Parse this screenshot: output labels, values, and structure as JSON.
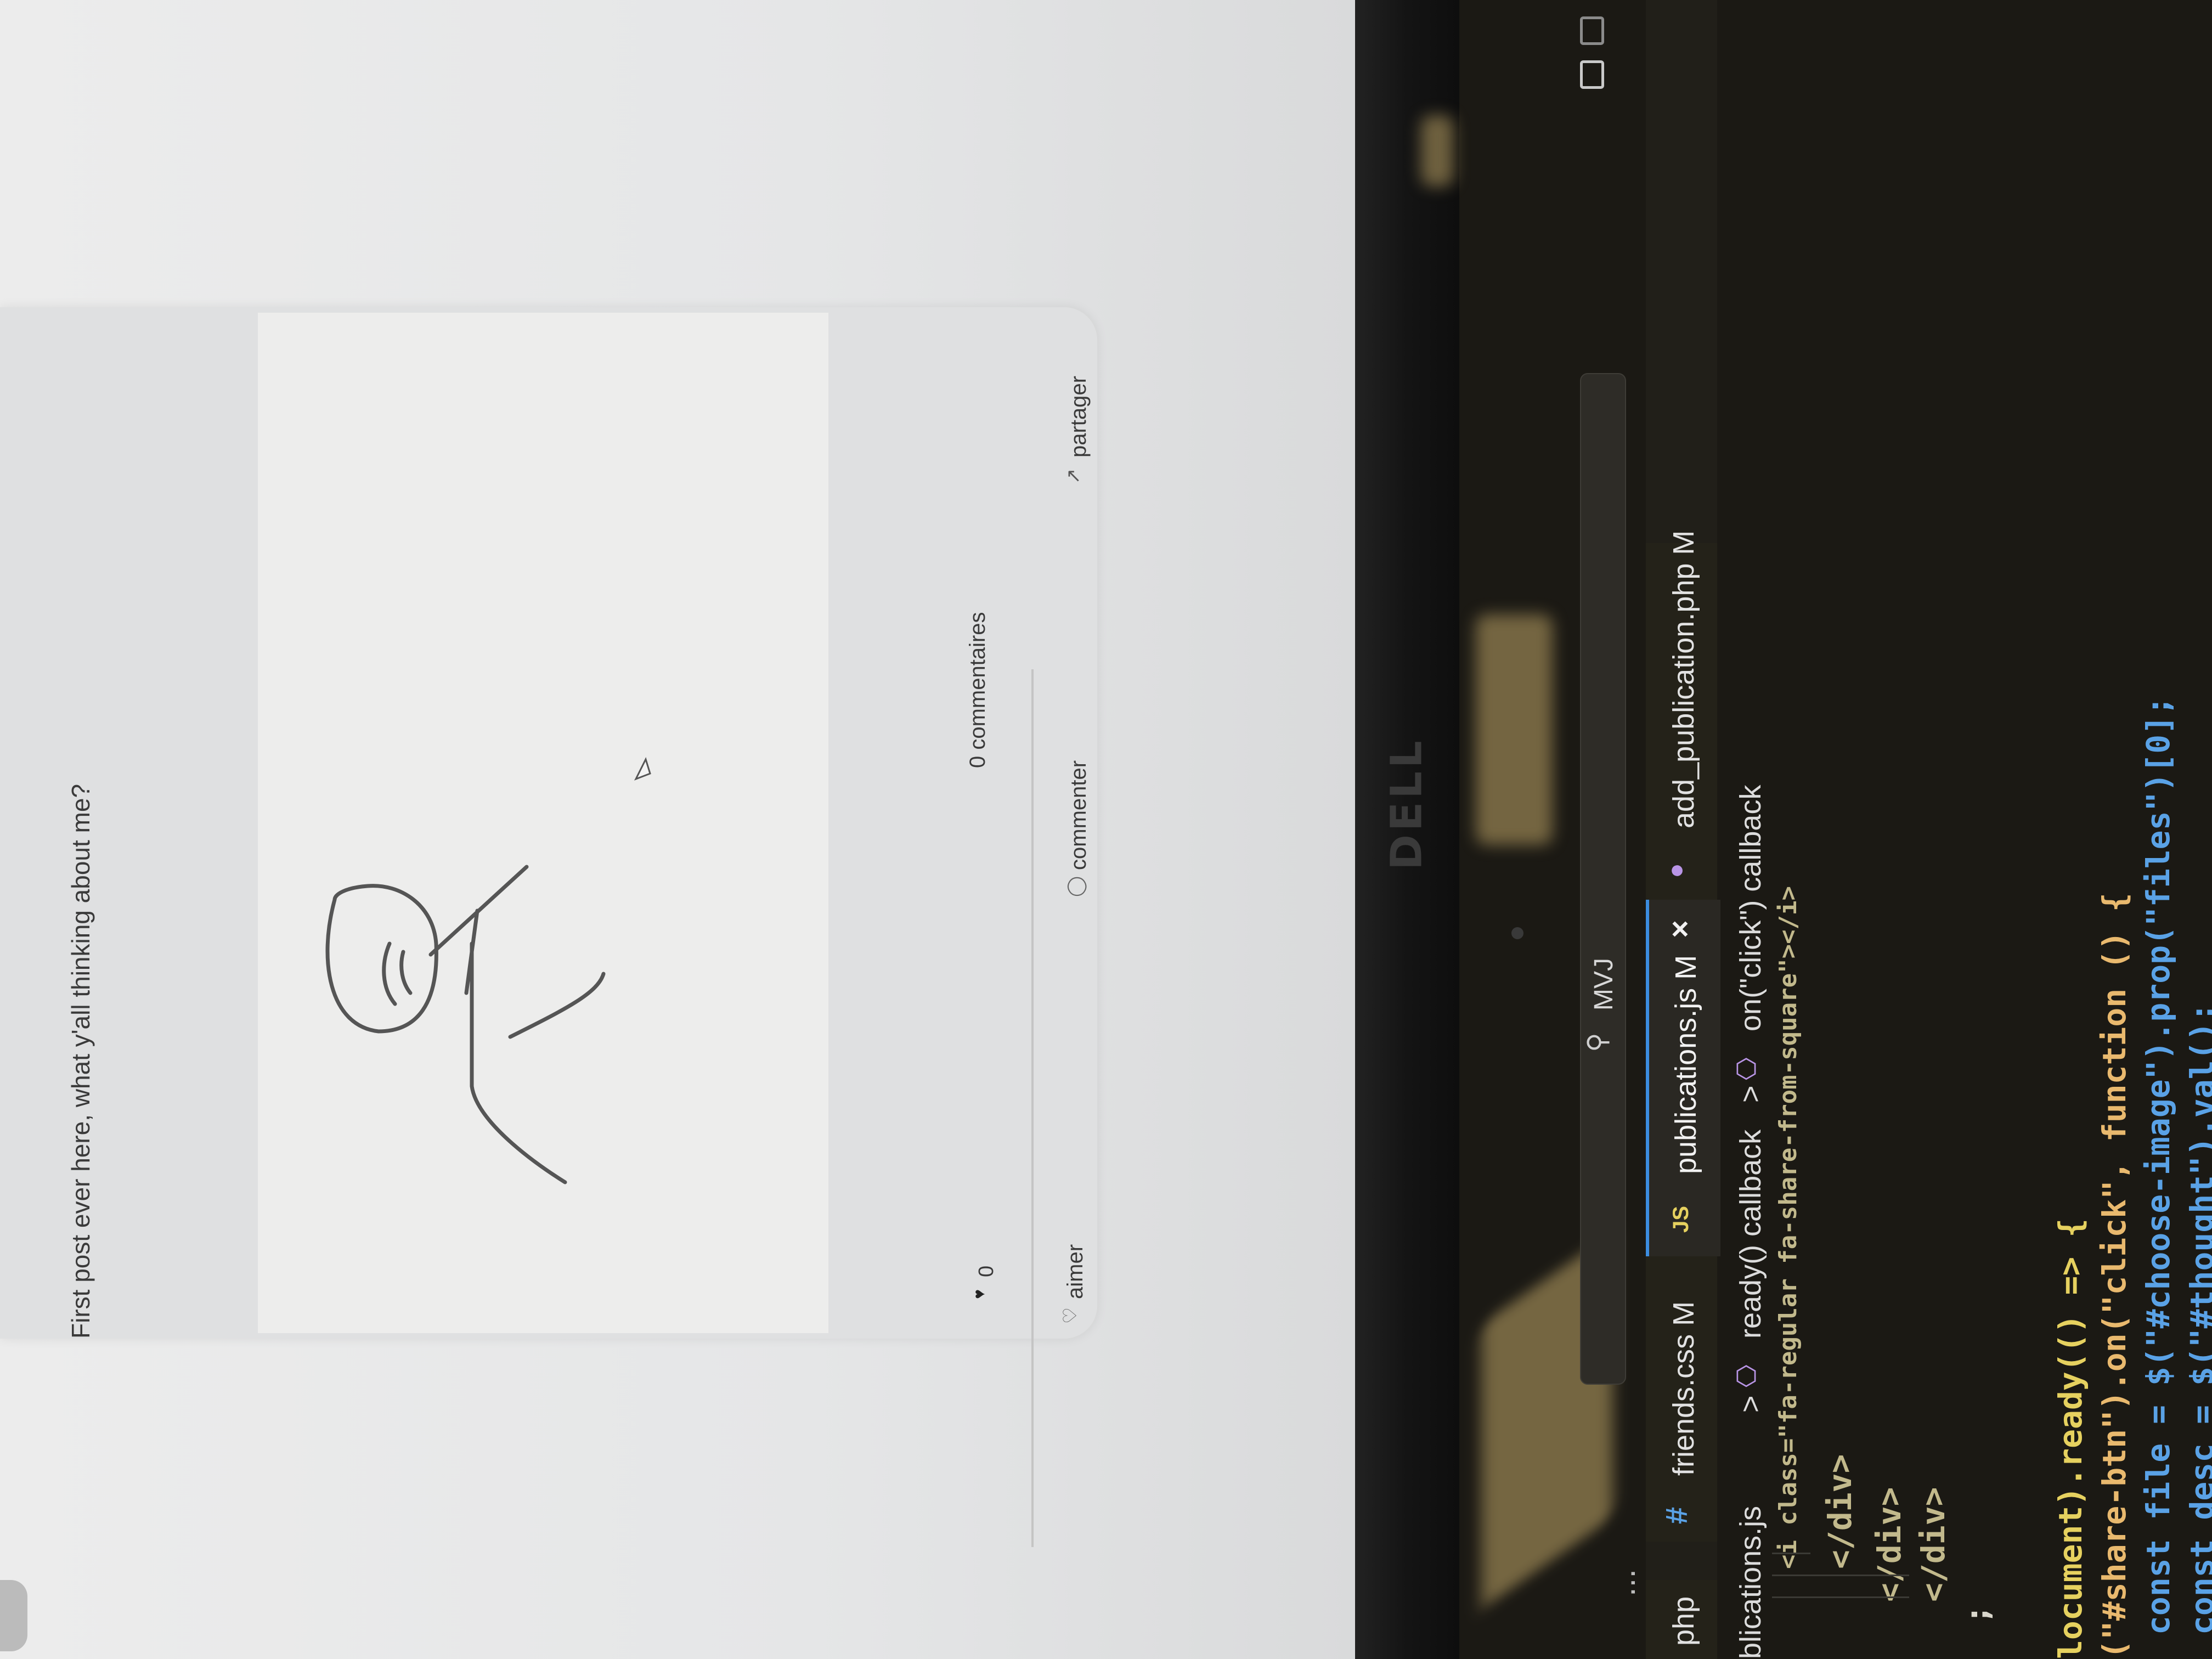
{
  "post": {
    "text": "First post ever here, what y'all thinking about me?",
    "likes_count": "0",
    "comments_count": "0 commentaires",
    "actions": {
      "like": "aimer",
      "comment": "commenter",
      "share": "partager"
    }
  },
  "laptop": {
    "brand": "DELL"
  },
  "editor": {
    "tabs": [
      {
        "label": "php"
      },
      {
        "label": "friends.css M"
      },
      {
        "label": "publications.js M"
      },
      {
        "label": "add_publication.php M"
      }
    ],
    "search_placeholder": "MVJ",
    "breadcrumb": {
      "file": "blications.js",
      "sep1": ">",
      "item1": "ready() callback",
      "sep2": ">",
      "item2": "on(\"click\") callback"
    },
    "code_lines": [
      "<i class=\"fa-regular fa-share-from-square\"></i>",
      "</div>",
      "</div>",
      "</div>",
      ";",
      "locument).ready(() => {",
      "(\"#share-btn\").on(\"click\", function () {",
      "const file = $(\"#choose-image\").prop(\"files\")[0];",
      "const desc = $(\"#thought\").val();"
    ],
    "overflow_menu": "...",
    "colors": {
      "accent": "#3c8de0",
      "background": "#1b1914",
      "keyword": "#5aa2e6",
      "string": "#e9b96e"
    }
  }
}
